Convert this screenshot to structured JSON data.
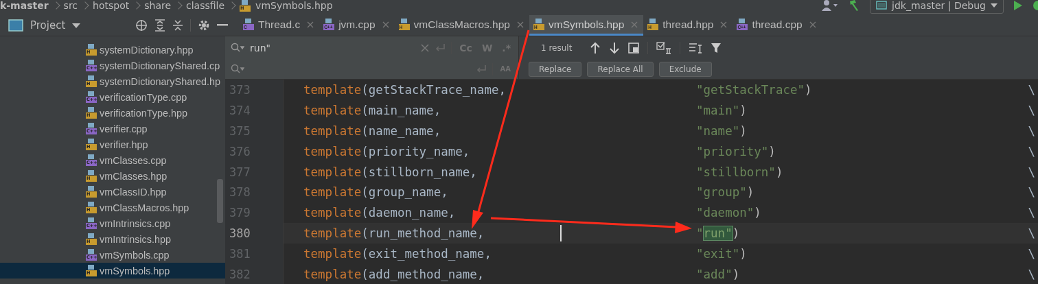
{
  "breadcrumbs": [
    {
      "label": "k-master",
      "bold": true
    },
    {
      "label": "src",
      "bold": false
    },
    {
      "label": "hotspot",
      "bold": false
    },
    {
      "label": "share",
      "bold": false
    },
    {
      "label": "classfile",
      "bold": false
    },
    {
      "label": "vmSymbols.hpp",
      "bold": false,
      "badge": "H",
      "color": "#c89b2e"
    }
  ],
  "run_config": {
    "label": "jdk_master | Debug"
  },
  "project_panel": {
    "title": "Project"
  },
  "tabs": [
    {
      "label": "Thread.c",
      "badge": "C",
      "color": "#8a66c4",
      "selected": false
    },
    {
      "label": "jvm.cpp",
      "badge": "C++",
      "color": "#8a66c4",
      "selected": false
    },
    {
      "label": "vmClassMacros.hpp",
      "badge": "H",
      "color": "#c89b2e",
      "selected": false
    },
    {
      "label": "vmSymbols.hpp",
      "badge": "H",
      "color": "#c89b2e",
      "selected": true
    },
    {
      "label": "thread.hpp",
      "badge": "H",
      "color": "#c89b2e",
      "selected": false
    },
    {
      "label": "thread.cpp",
      "badge": "C++",
      "color": "#8a66c4",
      "selected": false
    }
  ],
  "files": [
    {
      "label": "systemDictionary.hpp",
      "badge": "H",
      "color": "#c89b2e",
      "selected": false
    },
    {
      "label": "systemDictionaryShared.cp",
      "badge": "C++",
      "color": "#8a66c4",
      "selected": false
    },
    {
      "label": "systemDictionaryShared.hp",
      "badge": "H",
      "color": "#c89b2e",
      "selected": false
    },
    {
      "label": "verificationType.cpp",
      "badge": "C++",
      "color": "#8a66c4",
      "selected": false
    },
    {
      "label": "verificationType.hpp",
      "badge": "H",
      "color": "#c89b2e",
      "selected": false
    },
    {
      "label": "verifier.cpp",
      "badge": "C++",
      "color": "#8a66c4",
      "selected": false
    },
    {
      "label": "verifier.hpp",
      "badge": "H",
      "color": "#c89b2e",
      "selected": false
    },
    {
      "label": "vmClasses.cpp",
      "badge": "C++",
      "color": "#8a66c4",
      "selected": false
    },
    {
      "label": "vmClasses.hpp",
      "badge": "H",
      "color": "#c89b2e",
      "selected": false
    },
    {
      "label": "vmClassID.hpp",
      "badge": "H",
      "color": "#c89b2e",
      "selected": false
    },
    {
      "label": "vmClassMacros.hpp",
      "badge": "H",
      "color": "#c89b2e",
      "selected": false
    },
    {
      "label": "vmIntrinsics.cpp",
      "badge": "C++",
      "color": "#8a66c4",
      "selected": false
    },
    {
      "label": "vmIntrinsics.hpp",
      "badge": "H",
      "color": "#c89b2e",
      "selected": false
    },
    {
      "label": "vmSymbols.cpp",
      "badge": "C++",
      "color": "#8a66c4",
      "selected": false
    },
    {
      "label": "vmSymbols.hpp",
      "badge": "H",
      "color": "#c89b2e",
      "selected": true
    }
  ],
  "find": {
    "value": "run\"",
    "toggles": [
      {
        "label": "Cc",
        "selected": false
      },
      {
        "label": "W",
        "selected": false
      },
      {
        "label": ".*",
        "selected": false
      }
    ],
    "result": "1 result"
  },
  "replace": {
    "toggles": [
      {
        "label": "AA",
        "selected": false
      }
    ],
    "buttons": [
      "Replace",
      "Replace All",
      "Exclude"
    ]
  },
  "code_lines": [
    {
      "number": "373",
      "keyword": "template",
      "args": "(getStackTrace_name,",
      "string_parts": [
        {
          "text": "\"getStackTrace\"",
          "match": false
        }
      ],
      "tail": ")",
      "continuation": "\\",
      "current": false
    },
    {
      "number": "374",
      "keyword": "template",
      "args": "(main_name,",
      "string_parts": [
        {
          "text": "\"main\"",
          "match": false
        }
      ],
      "tail": ")",
      "continuation": "\\",
      "current": false
    },
    {
      "number": "375",
      "keyword": "template",
      "args": "(name_name,",
      "string_parts": [
        {
          "text": "\"name\"",
          "match": false
        }
      ],
      "tail": ")",
      "continuation": "\\",
      "current": false
    },
    {
      "number": "376",
      "keyword": "template",
      "args": "(priority_name,",
      "string_parts": [
        {
          "text": "\"priority\"",
          "match": false
        }
      ],
      "tail": ")",
      "continuation": "\\",
      "current": false
    },
    {
      "number": "377",
      "keyword": "template",
      "args": "(stillborn_name,",
      "string_parts": [
        {
          "text": "\"stillborn\"",
          "match": false
        }
      ],
      "tail": ")",
      "continuation": "\\",
      "current": false
    },
    {
      "number": "378",
      "keyword": "template",
      "args": "(group_name,",
      "string_parts": [
        {
          "text": "\"group\"",
          "match": false
        }
      ],
      "tail": ")",
      "continuation": "\\",
      "current": false
    },
    {
      "number": "379",
      "keyword": "template",
      "args": "(daemon_name,",
      "string_parts": [
        {
          "text": "\"daemon\"",
          "match": false
        }
      ],
      "tail": ")",
      "continuation": "\\",
      "current": false
    },
    {
      "number": "380",
      "keyword": "template",
      "args": "(run_method_name,",
      "string_parts": [
        {
          "text": "\"",
          "match": false
        },
        {
          "text": "run\"",
          "match": true
        }
      ],
      "tail": ")",
      "continuation": "\\",
      "current": true
    },
    {
      "number": "381",
      "keyword": "template",
      "args": "(exit_method_name,",
      "string_parts": [
        {
          "text": "\"exit\"",
          "match": false
        }
      ],
      "tail": ")",
      "continuation": "\\",
      "current": false
    },
    {
      "number": "382",
      "keyword": "template",
      "args": "(add_method_name,",
      "string_parts": [
        {
          "text": "\"add\"",
          "match": false
        }
      ],
      "tail": ")",
      "continuation": "\\",
      "current": false
    }
  ]
}
